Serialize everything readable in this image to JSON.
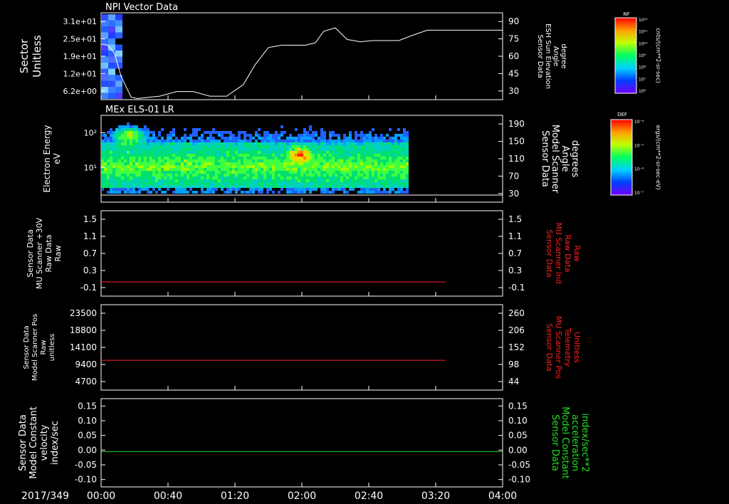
{
  "date_label": "2017/349",
  "time_ticks": [
    "00:00",
    "00:40",
    "01:20",
    "02:00",
    "02:40",
    "03:20",
    "04:00"
  ],
  "colors": {
    "background": "#000000",
    "frame": "#ffffff",
    "red": "#ff2020",
    "green": "#20e020"
  },
  "chart_data": [
    {
      "type": "heatmap",
      "title": "NPI Vector Data",
      "left_label": [
        "Sector",
        "Unitless"
      ],
      "left_ticks": [
        "3.1e+01",
        "2.5e+01",
        "1.9e+01",
        "1.2e+01",
        "6.2e+00"
      ],
      "right_label": [
        "Sensor Data",
        "ESH Sun Elevation",
        "Angle",
        "degree"
      ],
      "right_ticks": [
        "90",
        "75",
        "60",
        "45",
        "30"
      ],
      "line_series": {
        "name": "ESH Sun Elevation Angle",
        "x_minutes": [
          0,
          4,
          8,
          12,
          18,
          22,
          28,
          35,
          45,
          55,
          65,
          75,
          85,
          92,
          100,
          108,
          115,
          122,
          128,
          133,
          140,
          147,
          155,
          162,
          170,
          178,
          185,
          195,
          205,
          215,
          225,
          233,
          240
        ],
        "y_deg": [
          63,
          62,
          55,
          35,
          17,
          16,
          17,
          18,
          22,
          22,
          18,
          18,
          28,
          45,
          60,
          62,
          62,
          62,
          64,
          74,
          77,
          67,
          65,
          66,
          66,
          66,
          70,
          75,
          75,
          75,
          75,
          75,
          75
        ],
        "y_range": [
          15,
          90
        ]
      },
      "colorbar": {
        "label": "NF",
        "unit": "cnts/(cm**2-sr-sec)",
        "ticks": [
          "10¹²",
          "10¹¹",
          "10¹⁰",
          "10⁹",
          "10⁸",
          "10⁷",
          "10⁶"
        ]
      }
    },
    {
      "type": "heatmap",
      "title": "MEx ELS-01 LR",
      "left_label": [
        "Electron Energy",
        "eV"
      ],
      "left_ticks": [
        "10²",
        "10¹"
      ],
      "right_label": [
        "Sensor Data",
        "Model Scanner",
        "Angle",
        "degrees"
      ],
      "right_ticks": [
        "190",
        "150",
        "110",
        "70",
        "30"
      ],
      "colorbar": {
        "label": "DEF",
        "unit": "ergs/(cm**2-sr-sec-eV)",
        "ticks": [
          "10⁻⁴",
          "10⁻⁵",
          "10⁻⁶",
          "10⁻⁷"
        ]
      }
    },
    {
      "type": "line",
      "left_label": [
        "Sensor Data",
        "MU Scanner +30V",
        "Raw Data",
        "Raw"
      ],
      "left_ticks": [
        "1.5",
        "1.1",
        "0.7",
        "0.3",
        "-0.1"
      ],
      "right_label": [
        "Sensor Data",
        "MU Scanner Init",
        "Raw Data",
        "Raw"
      ],
      "right_ticks": [
        "1.5",
        "1.1",
        "0.7",
        "0.3",
        "-0.1"
      ],
      "y_range": [
        -0.3,
        1.5
      ],
      "series": [
        {
          "x_range_minutes": [
            0,
            206
          ],
          "value": 0.0
        }
      ]
    },
    {
      "type": "line",
      "left_label": [
        "Sensor Data",
        "Model Scanner Pos",
        "Raw",
        "unitless"
      ],
      "left_ticks": [
        "23500",
        "18800",
        "14100",
        "9400",
        "4700"
      ],
      "right_label": [
        "Sensor Data",
        "MU Scanner Pos",
        "Telemetry",
        "Unitless"
      ],
      "right_ticks": [
        "260",
        "206",
        "152",
        "98",
        "44"
      ],
      "y_range": [
        0,
        23500
      ],
      "series": [
        {
          "x_range_minutes": [
            0,
            206
          ],
          "value": 8200
        }
      ]
    },
    {
      "type": "line",
      "left_label": [
        "Sensor Data",
        "Model Constant",
        "velocity",
        "index/sec"
      ],
      "left_ticks": [
        "0.15",
        "0.10",
        "0.05",
        "0.00",
        "-0.05",
        "-0.10"
      ],
      "right_label": [
        "Sensor Data",
        "Model Constant",
        "acceleration",
        "index/sec**2"
      ],
      "right_ticks": [
        "0.15",
        "0.10",
        "0.05",
        "0.00",
        "-0.05",
        "-0.10"
      ],
      "y_range": [
        -0.1,
        0.15
      ],
      "series": [
        {
          "x_range_minutes": [
            0,
            240
          ],
          "value": 0.0
        }
      ]
    }
  ]
}
